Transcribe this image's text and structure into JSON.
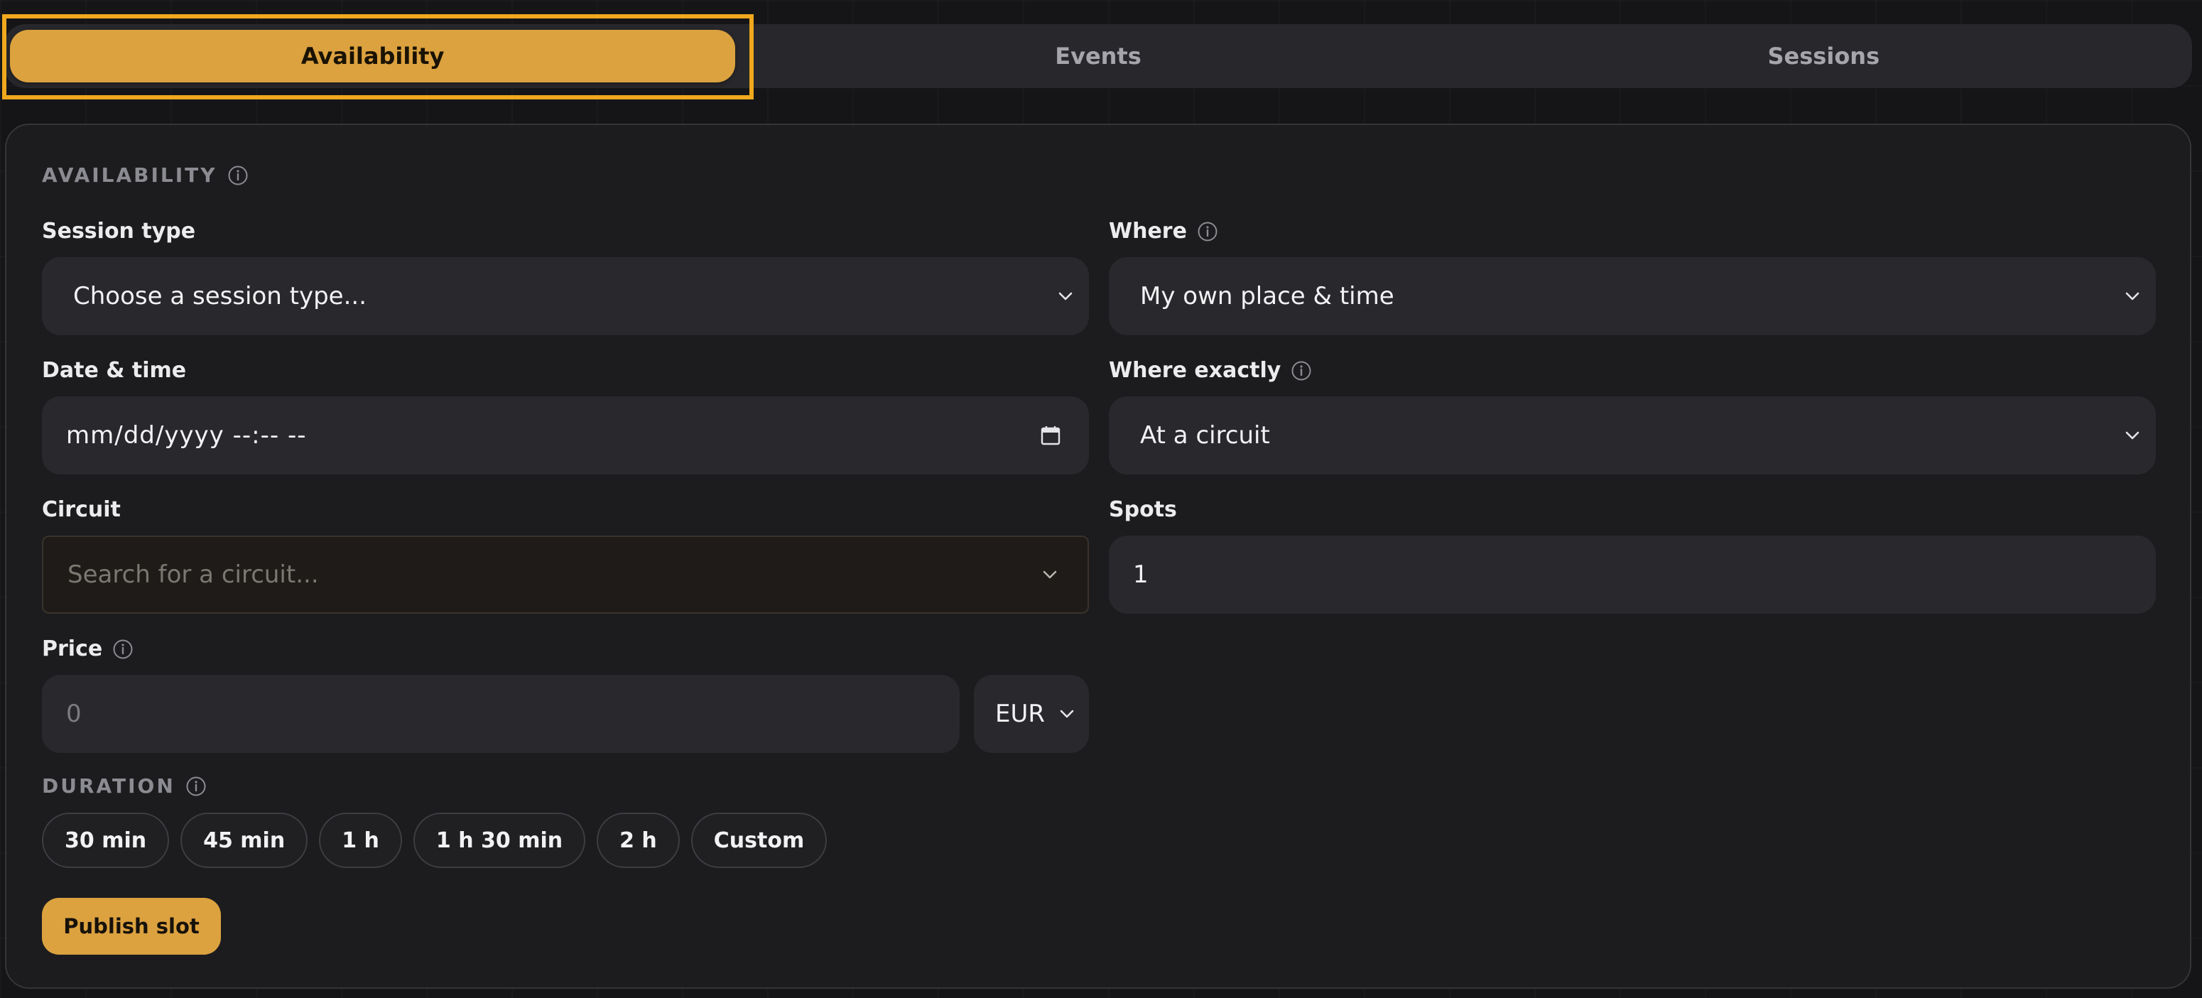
{
  "tabs": [
    {
      "label": "Availability",
      "active": true
    },
    {
      "label": "Events",
      "active": false
    },
    {
      "label": "Sessions",
      "active": false
    }
  ],
  "form": {
    "section_title": "AVAILABILITY",
    "session_type": {
      "label": "Session type",
      "value": "Choose a session type..."
    },
    "where": {
      "label": "Where",
      "value": "My own place & time"
    },
    "date_time": {
      "label": "Date & time",
      "value": "mm/dd/yyyy --:-- --"
    },
    "where_exactly": {
      "label": "Where exactly",
      "value": "At a circuit"
    },
    "circuit": {
      "label": "Circuit",
      "placeholder": "Search for a circuit..."
    },
    "spots": {
      "label": "Spots",
      "value": "1"
    },
    "price": {
      "label": "Price",
      "placeholder": "0",
      "currency": "EUR"
    },
    "duration": {
      "title": "DURATION",
      "options": [
        "30 min",
        "45 min",
        "1 h",
        "1 h 30 min",
        "2 h",
        "Custom"
      ]
    },
    "publish_label": "Publish slot"
  },
  "icons": {
    "info": "info-icon",
    "chevron": "chevron-down-icon",
    "calendar": "calendar-icon"
  },
  "colors": {
    "accent": "#dca23f",
    "highlight": "#f0a81e",
    "background": "#151517",
    "card": "#1c1c1f",
    "control": "#29292d"
  }
}
